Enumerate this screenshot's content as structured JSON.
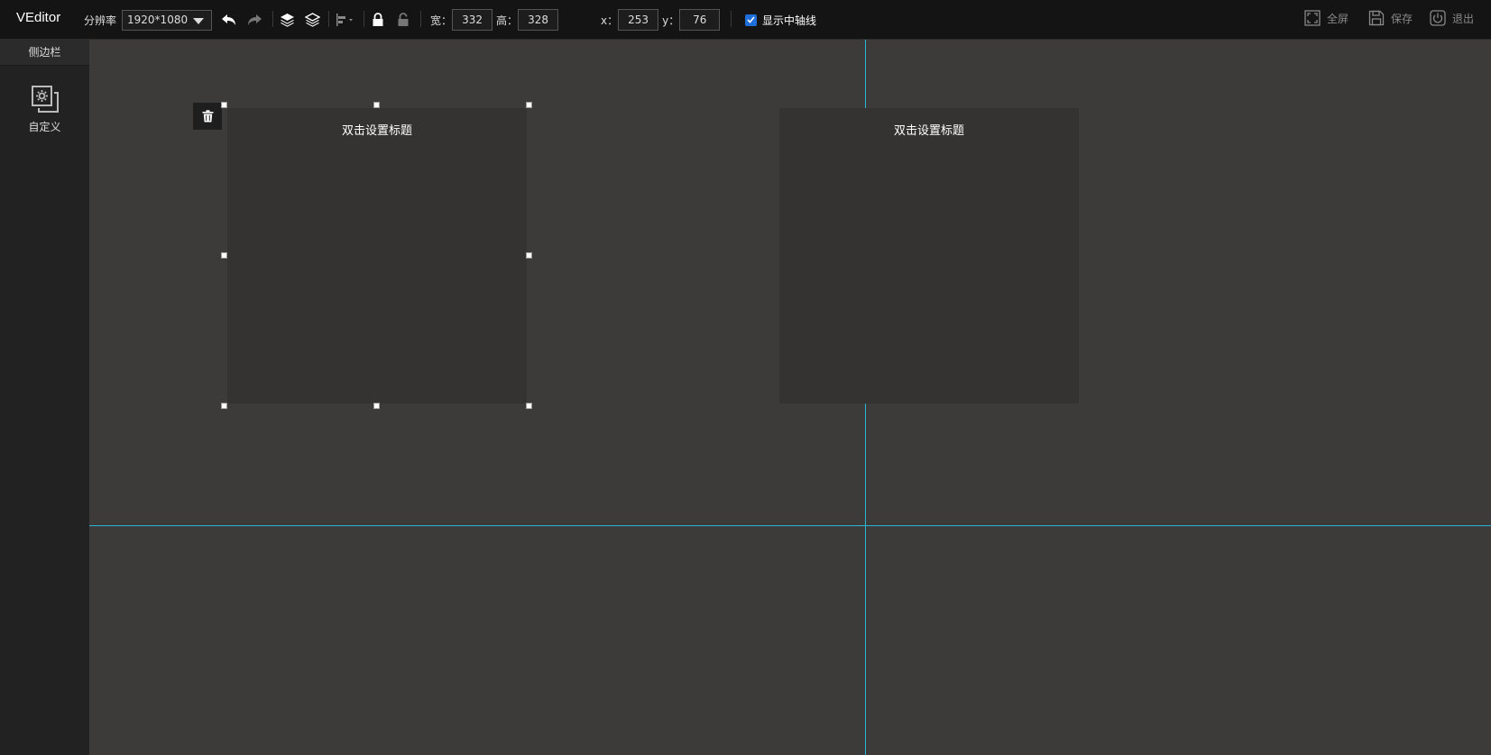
{
  "app": {
    "title": "VEditor"
  },
  "toolbar": {
    "resolution_label": "分辨率",
    "resolution_value": "1920*1080",
    "width_label": "宽：",
    "width_value": "332",
    "height_label": "高：",
    "height_value": "328",
    "x_label": "x：",
    "x_value": "253",
    "y_label": "y：",
    "y_value": "76",
    "show_axis_label": "显示中轴线",
    "show_axis_checked": true,
    "icons": [
      "undo-icon",
      "redo-icon",
      "layer-up-icon",
      "layer-down-icon",
      "align-icon",
      "lock-icon",
      "unlock-icon"
    ]
  },
  "actions": {
    "fullscreen_label": "全屏",
    "save_label": "保存",
    "exit_label": "退出"
  },
  "sidebar": {
    "title": "侧边栏",
    "items": [
      {
        "label": "自定义",
        "icon": "custom-settings-icon"
      }
    ]
  },
  "canvas": {
    "panels": [
      {
        "title": "双击设置标题",
        "selected": true
      },
      {
        "title": "双击设置标题",
        "selected": false
      }
    ],
    "axis_color": "#2bb4d6",
    "background": "#3c3b39",
    "panel_color": "#343331"
  }
}
